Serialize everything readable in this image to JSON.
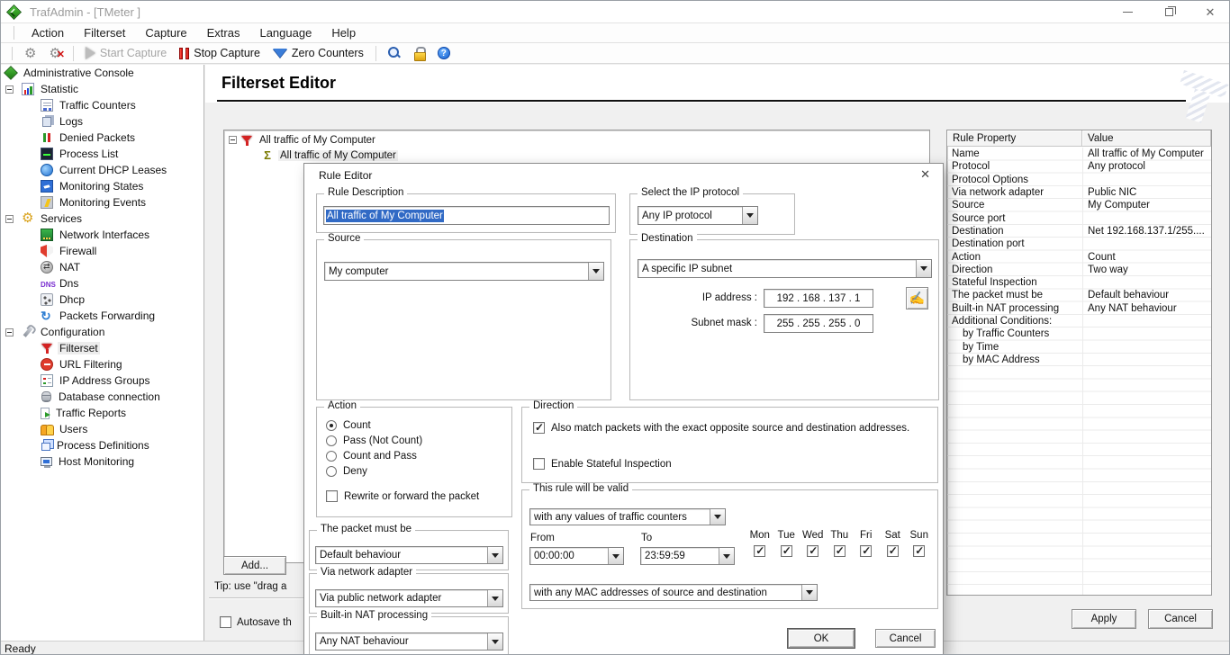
{
  "titlebar": {
    "title": "TrafAdmin - [TMeter ]"
  },
  "menubar": {
    "items": [
      "Action",
      "Filterset",
      "Capture",
      "Extras",
      "Language",
      "Help"
    ]
  },
  "toolbar": {
    "start_capture": "Start Capture",
    "stop_capture": "Stop Capture",
    "zero_counters": "Zero Counters"
  },
  "sidebar": {
    "items": [
      {
        "label": "Administrative Console",
        "icon": "admin",
        "level": 0
      },
      {
        "label": "Statistic",
        "icon": "statistic",
        "level": 1,
        "expand": true
      },
      {
        "label": "Traffic Counters",
        "icon": "traffic-counters",
        "level": 2
      },
      {
        "label": "Logs",
        "icon": "logs",
        "level": 2
      },
      {
        "label": "Denied Packets",
        "icon": "denied-packets",
        "level": 2
      },
      {
        "label": "Process List",
        "icon": "process-list",
        "level": 2
      },
      {
        "label": "Current DHCP Leases",
        "icon": "dhcp-leases",
        "level": 2
      },
      {
        "label": "Monitoring States",
        "icon": "monitoring-states",
        "level": 2
      },
      {
        "label": "Monitoring Events",
        "icon": "monitoring-events",
        "level": 2
      },
      {
        "label": "Services",
        "icon": "services",
        "level": 1,
        "expand": true
      },
      {
        "label": "Network Interfaces",
        "icon": "network-interfaces",
        "level": 2
      },
      {
        "label": "Firewall",
        "icon": "firewall",
        "level": 2
      },
      {
        "label": "NAT",
        "icon": "nat",
        "level": 2
      },
      {
        "label": "Dns",
        "icon": "dns",
        "level": 2
      },
      {
        "label": "Dhcp",
        "icon": "dhcp",
        "level": 2
      },
      {
        "label": "Packets Forwarding",
        "icon": "packets-forwarding",
        "level": 2
      },
      {
        "label": "Configuration",
        "icon": "configuration",
        "level": 1,
        "expand": true
      },
      {
        "label": "Filterset",
        "icon": "filterset",
        "level": 2,
        "selected": true
      },
      {
        "label": "URL Filtering",
        "icon": "url-filtering",
        "level": 2
      },
      {
        "label": "IP Address Groups",
        "icon": "ip-groups",
        "level": 2
      },
      {
        "label": "Database connection",
        "icon": "database",
        "level": 2
      },
      {
        "label": "Traffic Reports",
        "icon": "traffic-reports",
        "level": 2
      },
      {
        "label": "Users",
        "icon": "users",
        "level": 2
      },
      {
        "label": "Process Definitions",
        "icon": "process-definitions",
        "level": 2
      },
      {
        "label": "Host Monitoring",
        "icon": "host-monitoring",
        "level": 2
      }
    ]
  },
  "content": {
    "heading": "Filterset Editor",
    "rule_tree": {
      "parent_label": "All traffic of My Computer",
      "child_label": "All traffic of My Computer"
    },
    "add_button": "Add...",
    "tip_text": "Tip: use \"drag a",
    "autosave_label": "Autosave th",
    "apply_button": "Apply",
    "cancel_button": "Cancel"
  },
  "properties_panel": {
    "headers": [
      "Rule Property",
      "Value"
    ],
    "rows": [
      {
        "property": "Name",
        "value": "All traffic of My Computer"
      },
      {
        "property": "Protocol",
        "value": "Any protocol"
      },
      {
        "property": "Protocol Options",
        "value": ""
      },
      {
        "property": "Via network adapter",
        "value": "Public NIC"
      },
      {
        "property": "Source",
        "value": "My Computer"
      },
      {
        "property": "Source port",
        "value": ""
      },
      {
        "property": "Destination",
        "value": "Net 192.168.137.1/255...."
      },
      {
        "property": "Destination port",
        "value": ""
      },
      {
        "property": "Action",
        "value": "Count"
      },
      {
        "property": "Direction",
        "value": "Two way"
      },
      {
        "property": "Stateful Inspection",
        "value": ""
      },
      {
        "property": "The packet must be",
        "value": "Default behaviour"
      },
      {
        "property": "Built-in NAT processing",
        "value": "Any NAT behaviour"
      },
      {
        "property": "Additional Conditions:",
        "value": ""
      },
      {
        "property": "by Traffic Counters",
        "value": "",
        "indent": true
      },
      {
        "property": "by Time",
        "value": "",
        "indent": true
      },
      {
        "property": "by MAC Address",
        "value": "",
        "indent": true
      }
    ]
  },
  "dialog": {
    "title": "Rule Editor",
    "rule_description": {
      "label": "Rule Description",
      "value": "All traffic of My Computer"
    },
    "ip_protocol": {
      "label": "Select the IP protocol",
      "value": "Any IP protocol"
    },
    "source": {
      "label": "Source",
      "value": "My computer"
    },
    "destination": {
      "label": "Destination",
      "value": "A specific IP subnet",
      "ip_label": "IP address :",
      "ip_value": "192 . 168 . 137 . 1",
      "mask_label": "Subnet mask :",
      "mask_value": "255 . 255 . 255 . 0"
    },
    "action": {
      "label": "Action",
      "options": [
        {
          "label": "Count",
          "selected": true
        },
        {
          "label": "Pass (Not Count)",
          "selected": false
        },
        {
          "label": "Count and Pass",
          "selected": false
        },
        {
          "label": "Deny",
          "selected": false
        }
      ],
      "rewrite_label": "Rewrite or forward the packet",
      "rewrite_checked": false
    },
    "direction": {
      "label": "Direction",
      "match_opposite_label": "Also match packets with the exact opposite source and destination addresses.",
      "match_opposite_checked": true,
      "stateful_label": "Enable Stateful Inspection",
      "stateful_checked": false
    },
    "valid": {
      "label": "This rule will be valid",
      "traffic_counters_value": "with any values of traffic counters",
      "from_label": "From",
      "to_label": "To",
      "from_value": "00:00:00",
      "to_value": "23:59:59",
      "days": [
        "Mon",
        "Tue",
        "Wed",
        "Thu",
        "Fri",
        "Sat",
        "Sun"
      ],
      "days_checked": [
        true,
        true,
        true,
        true,
        true,
        true,
        true
      ],
      "mac_value": "with any MAC addresses of source and destination"
    },
    "packet_must_be": {
      "label": "The packet must be",
      "value": "Default behaviour"
    },
    "via_adapter": {
      "label": "Via network adapter",
      "value": "Via public network adapter"
    },
    "nat": {
      "label": "Built-in NAT processing",
      "value": "Any NAT behaviour"
    },
    "ok_button": "OK",
    "cancel_button": "Cancel"
  },
  "statusbar": {
    "text": "Ready"
  },
  "colors": {
    "selection_blue": "#316ac5",
    "funnel_red": "#d42222",
    "sigma_olive": "#7a7a00"
  }
}
